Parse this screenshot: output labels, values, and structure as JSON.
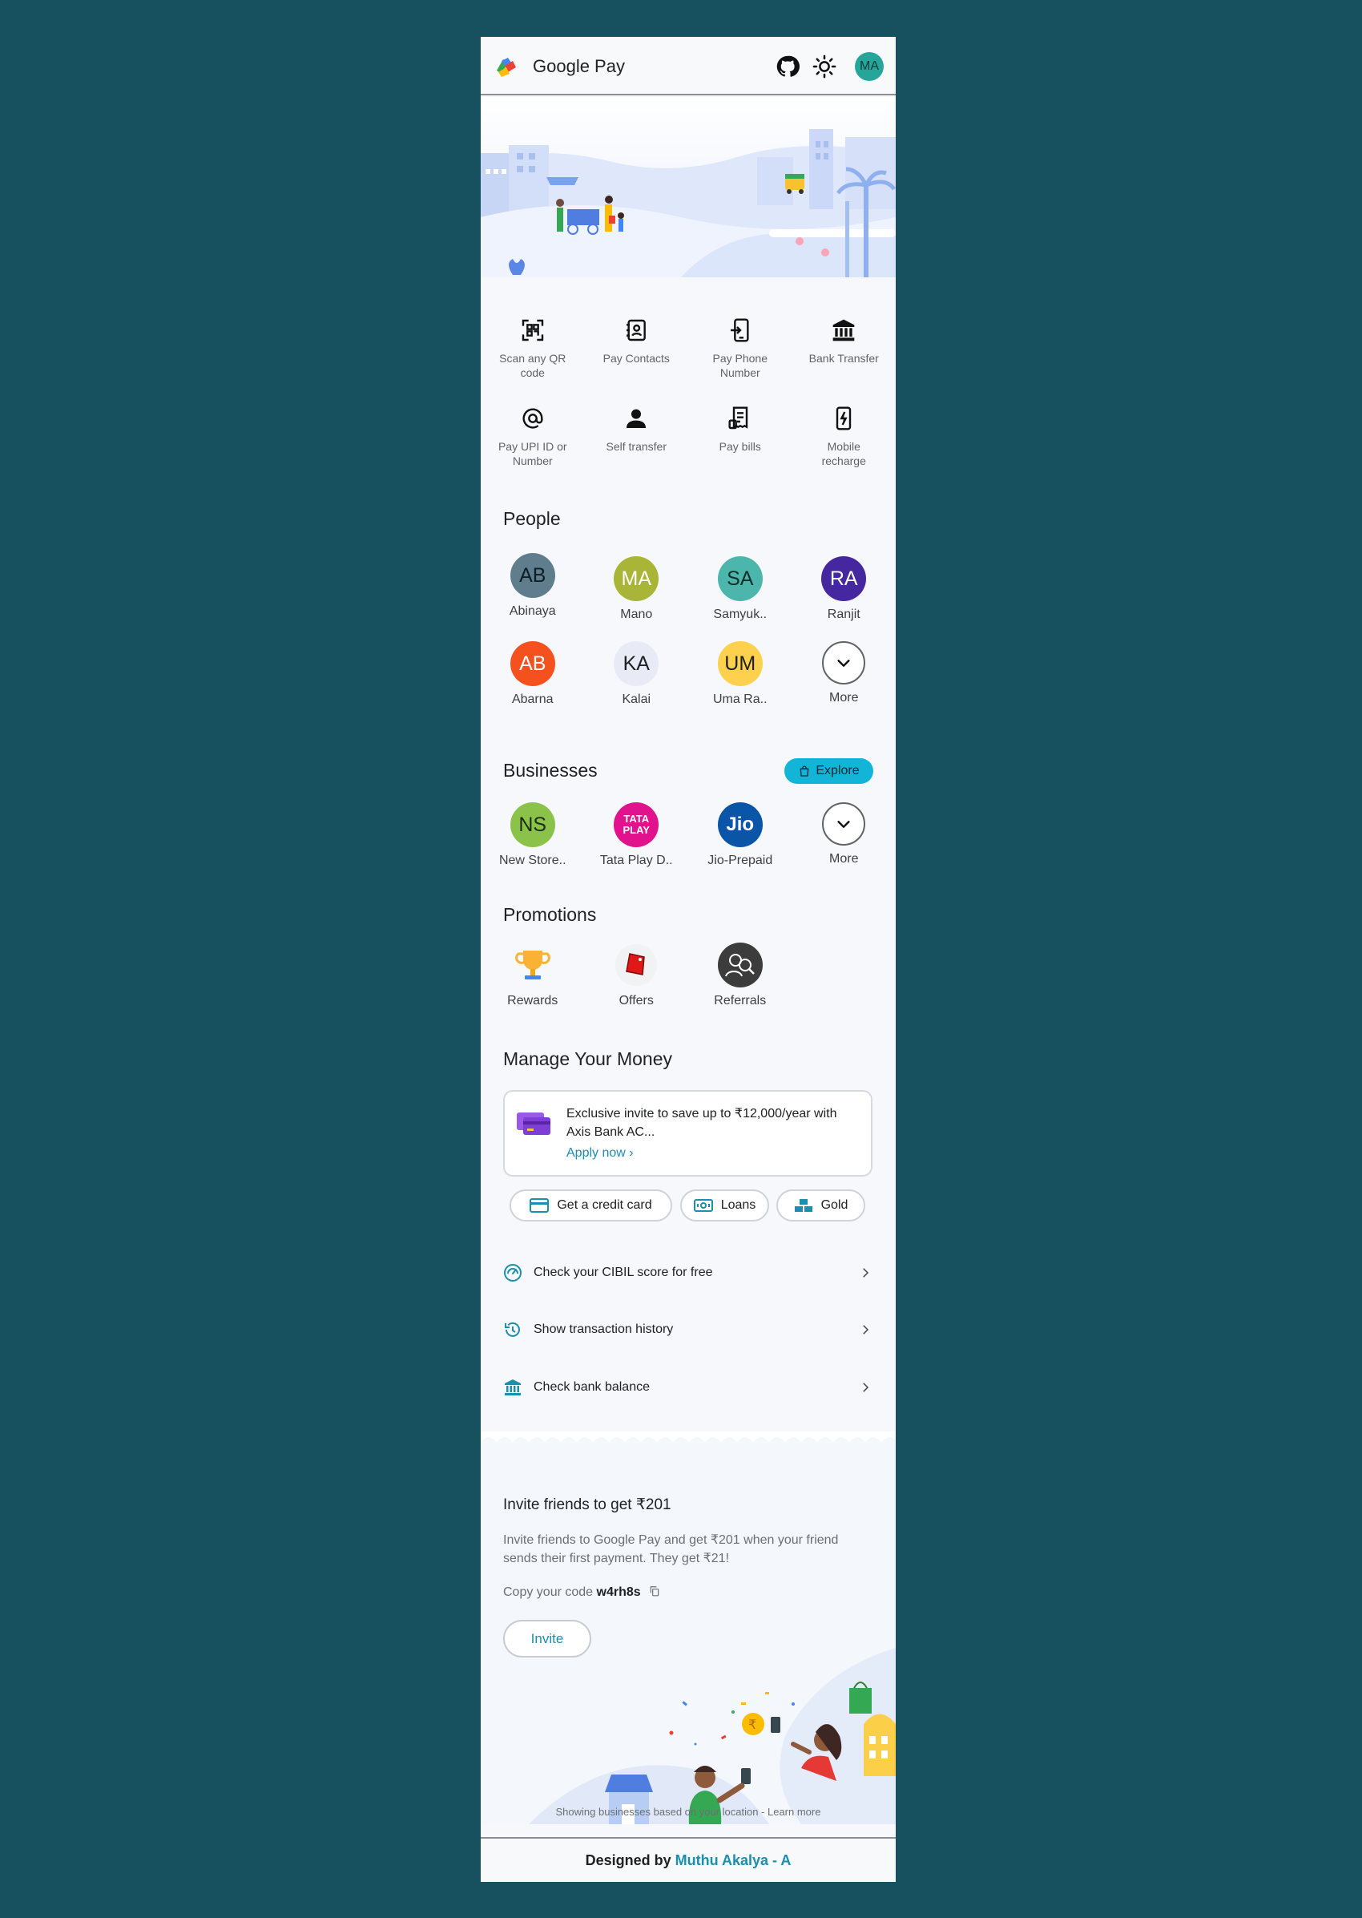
{
  "header": {
    "app_title": "Google Pay",
    "avatar_initials": "MA",
    "icons": [
      "github-icon",
      "sun-icon"
    ]
  },
  "quick_actions": [
    {
      "label": "Scan any QR code",
      "icon": "qr-scan-icon"
    },
    {
      "label": "Pay Contacts",
      "icon": "contacts-icon"
    },
    {
      "label": "Pay Phone Number",
      "icon": "phone-transfer-icon"
    },
    {
      "label": "Bank Transfer",
      "icon": "bank-icon"
    },
    {
      "label": "Pay UPI ID or Number",
      "icon": "at-icon"
    },
    {
      "label": "Self transfer",
      "icon": "person-icon"
    },
    {
      "label": "Pay bills",
      "icon": "receipt-icon"
    },
    {
      "label": "Mobile recharge",
      "icon": "mobile-recharge-icon"
    }
  ],
  "people": {
    "title": "People",
    "items": [
      {
        "initials": "AB",
        "name": "Abinaya",
        "color": "#5f7d8c"
      },
      {
        "initials": "MA",
        "name": "Mano",
        "color": "#a8b536"
      },
      {
        "initials": "SA",
        "name": "Samyuk..",
        "color": "#4db6ac"
      },
      {
        "initials": "RA",
        "name": "Ranjit",
        "color": "#4527a0"
      },
      {
        "initials": "AB",
        "name": "Abarna",
        "color": "#f4511e"
      },
      {
        "initials": "KA",
        "name": "Kalai",
        "color": "#e8eaf6"
      },
      {
        "initials": "UM",
        "name": "Uma Ra..",
        "color": "#fdd04d"
      }
    ],
    "more_label": "More"
  },
  "businesses": {
    "title": "Businesses",
    "explore_label": "Explore",
    "items": [
      {
        "initials": "NS",
        "name": "New Store..",
        "color": "#8bc34a"
      },
      {
        "logo_text_1": "TATA",
        "logo_text_2": "PLAY",
        "name": "Tata Play D..",
        "color": "#e0128c"
      },
      {
        "logo_text": "Jio",
        "name": "Jio-Prepaid",
        "color": "#0a55a8"
      }
    ],
    "more_label": "More"
  },
  "promotions": {
    "title": "Promotions",
    "items": [
      {
        "name": "Rewards",
        "icon": "trophy-icon"
      },
      {
        "name": "Offers",
        "icon": "offer-tag-icon"
      },
      {
        "name": "Referrals",
        "icon": "referral-icon"
      }
    ]
  },
  "manage_money": {
    "title": "Manage Your Money",
    "promo_text": "Exclusive invite to save up to ₹12,000/year with Axis Bank AC...",
    "apply_now": "Apply now",
    "chips": [
      {
        "label": "Get a credit card",
        "icon": "credit-card-icon"
      },
      {
        "label": "Loans",
        "icon": "loan-icon"
      },
      {
        "label": "Gold",
        "icon": "gold-icon"
      }
    ],
    "list": [
      {
        "label": "Check your CIBIL score for free",
        "icon": "speedometer-icon"
      },
      {
        "label": "Show transaction history",
        "icon": "history-icon"
      },
      {
        "label": "Check bank balance",
        "icon": "bank-icon"
      }
    ]
  },
  "invite": {
    "title": "Invite friends to get ₹201",
    "description": "Invite friends to Google Pay and get ₹201 when your friend sends their first payment. They get ₹21!",
    "code_prefix": "Copy your code",
    "code": "w4rh8s",
    "button": "Invite"
  },
  "location_note": "Showing businesses based on your location - Learn more",
  "footer": {
    "prefix": "Designed by",
    "author": "Muthu Akalya - A"
  },
  "colors": {
    "accent": "#1a8fae",
    "page_bg": "#17505f",
    "explore_bg": "#12b5d8"
  }
}
